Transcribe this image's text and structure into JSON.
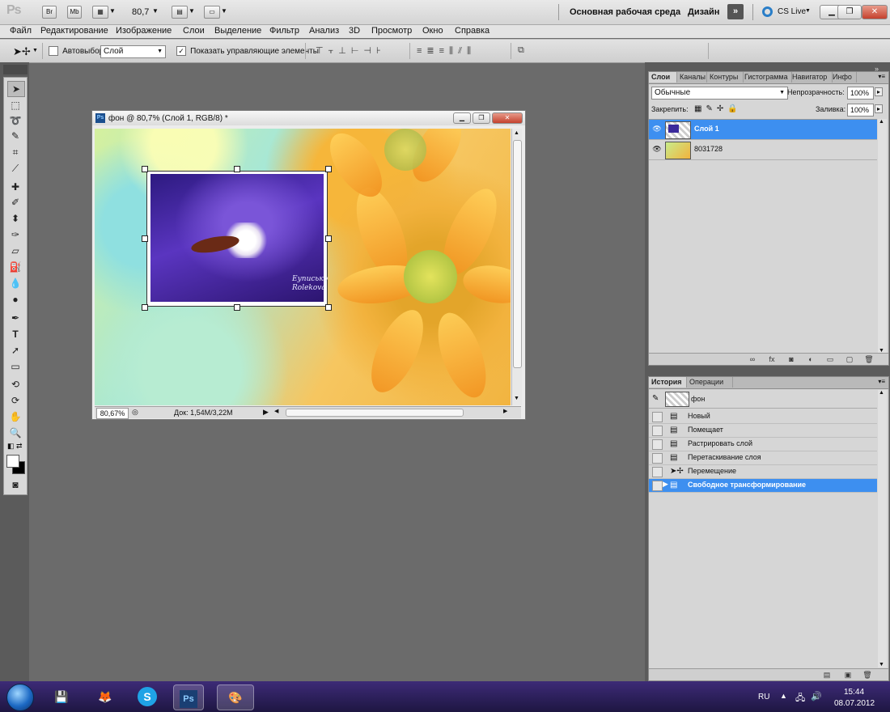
{
  "appbar": {
    "logo": "Ps",
    "br": "Br",
    "mb": "Mb",
    "zoom": "80,7",
    "workspace_label": "Основная рабочая среда",
    "design_label": "Дизайн",
    "cslive_label": "CS Live"
  },
  "menu": [
    "Файл",
    "Редактирование",
    "Изображение",
    "Слои",
    "Выделение",
    "Фильтр",
    "Анализ",
    "3D",
    "Просмотр",
    "Окно",
    "Справка"
  ],
  "options": {
    "autoselect_label": "Автовыбор:",
    "autoselect_value": "Слой",
    "show_controls_label": "Показать управляющие элементы"
  },
  "document": {
    "title": "фон @ 80,7% (Слой 1, RGB/8) *",
    "zoom": "80,67%",
    "doc_info": "Док: 1,54M/3,22M",
    "watermark_line1": "Eуписько",
    "watermark_line2": "Rolekova"
  },
  "layers_panel": {
    "tabs": [
      "Слои",
      "Каналы",
      "Контуры",
      "Гистограмма",
      "Навигатор",
      "Инфо"
    ],
    "blend_mode": "Обычные",
    "opacity_label": "Непрозрачность:",
    "opacity_value": "100%",
    "lock_label": "Закрепить:",
    "fill_label": "Заливка:",
    "fill_value": "100%",
    "layers": [
      {
        "name": "Слой 1",
        "selected": true
      },
      {
        "name": "8031728",
        "selected": false
      }
    ]
  },
  "history_panel": {
    "tabs": [
      "История",
      "Операции"
    ],
    "snapshot": "фон",
    "items": [
      {
        "name": "Новый",
        "selected": false
      },
      {
        "name": "Помещает",
        "selected": false
      },
      {
        "name": "Растрировать слой",
        "selected": false
      },
      {
        "name": "Перетаскивание слоя",
        "selected": false
      },
      {
        "name": "Перемещение",
        "selected": false
      },
      {
        "name": "Свободное трансформирование",
        "selected": true
      }
    ]
  },
  "taskbar": {
    "lang": "RU",
    "time": "15:44",
    "date": "08.07.2012",
    "ps_label": "Ps"
  }
}
